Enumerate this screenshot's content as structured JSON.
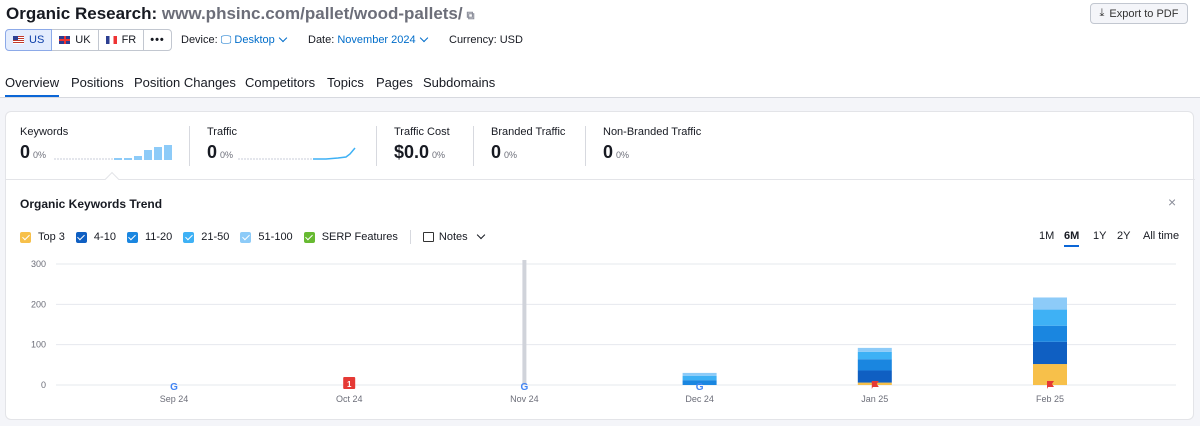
{
  "header": {
    "title_prefix": "Organic Research:",
    "domain": "www.phsinc.com/pallet/wood-pallets/",
    "export_label": "Export to PDF"
  },
  "databases": [
    {
      "code": "US",
      "flag": "us",
      "active": true
    },
    {
      "code": "UK",
      "flag": "uk",
      "active": false
    },
    {
      "code": "FR",
      "flag": "fr",
      "active": false
    }
  ],
  "more_label": "•••",
  "filters": {
    "device_label": "Device:",
    "device_value": "Desktop",
    "date_label": "Date:",
    "date_value": "November 2024",
    "currency": "Currency: USD"
  },
  "tabs": [
    "Overview",
    "Positions",
    "Position Changes",
    "Competitors",
    "Topics",
    "Pages",
    "Subdomains"
  ],
  "active_tab": "Overview",
  "metrics": [
    {
      "label": "Keywords",
      "value": "0",
      "change": "0%"
    },
    {
      "label": "Traffic",
      "value": "0",
      "change": "0%"
    },
    {
      "label": "Traffic Cost",
      "value": "$0.0",
      "change": "0%"
    },
    {
      "label": "Branded Traffic",
      "value": "0",
      "change": "0%"
    },
    {
      "label": "Non-Branded Traffic",
      "value": "0",
      "change": "0%"
    }
  ],
  "trend": {
    "title": "Organic Keywords Trend",
    "legend": [
      {
        "label": "Top 3",
        "color": "#f7c04a"
      },
      {
        "label": "4-10",
        "color": "#0f5fc2"
      },
      {
        "label": "11-20",
        "color": "#1a86e0"
      },
      {
        "label": "21-50",
        "color": "#3eb1f5"
      },
      {
        "label": "51-100",
        "color": "#8dcbf8"
      },
      {
        "label": "SERP Features",
        "color": "#67ba31"
      }
    ],
    "notes_label": "Notes",
    "periods": [
      "1M",
      "6M",
      "1Y",
      "2Y",
      "All time"
    ],
    "active_period": "6M",
    "close_label": "×"
  },
  "chart_data": {
    "type": "bar",
    "stacked": true,
    "categories": [
      "Sep 24",
      "Oct 24",
      "Nov 24",
      "Dec 24",
      "Jan 25",
      "Feb 25"
    ],
    "yticks": [
      0,
      100,
      200,
      300
    ],
    "ylim": [
      0,
      330
    ],
    "series": [
      {
        "name": "Top 3",
        "color": "#f7c04a",
        "values": [
          0,
          0,
          0,
          0,
          6,
          52
        ]
      },
      {
        "name": "4-10",
        "color": "#0f5fc2",
        "values": [
          0,
          0,
          0,
          0,
          30,
          55
        ]
      },
      {
        "name": "11-20",
        "color": "#1a86e0",
        "values": [
          0,
          0,
          0,
          12,
          28,
          40
        ]
      },
      {
        "name": "21-50",
        "color": "#3eb1f5",
        "values": [
          0,
          0,
          0,
          11,
          18,
          40
        ]
      },
      {
        "name": "51-100",
        "color": "#8dcbf8",
        "values": [
          0,
          0,
          0,
          7,
          10,
          30
        ]
      }
    ],
    "markers": [
      {
        "category": "Sep 24",
        "kind": "google"
      },
      {
        "category": "Oct 24",
        "kind": "note",
        "label": "1"
      },
      {
        "category": "Nov 24",
        "kind": "google"
      },
      {
        "category": "Dec 24",
        "kind": "google"
      },
      {
        "category": "Jan 25",
        "kind": "flag"
      },
      {
        "category": "Feb 25",
        "kind": "flag"
      }
    ],
    "highlight_category": "Nov 24",
    "grid": true
  }
}
